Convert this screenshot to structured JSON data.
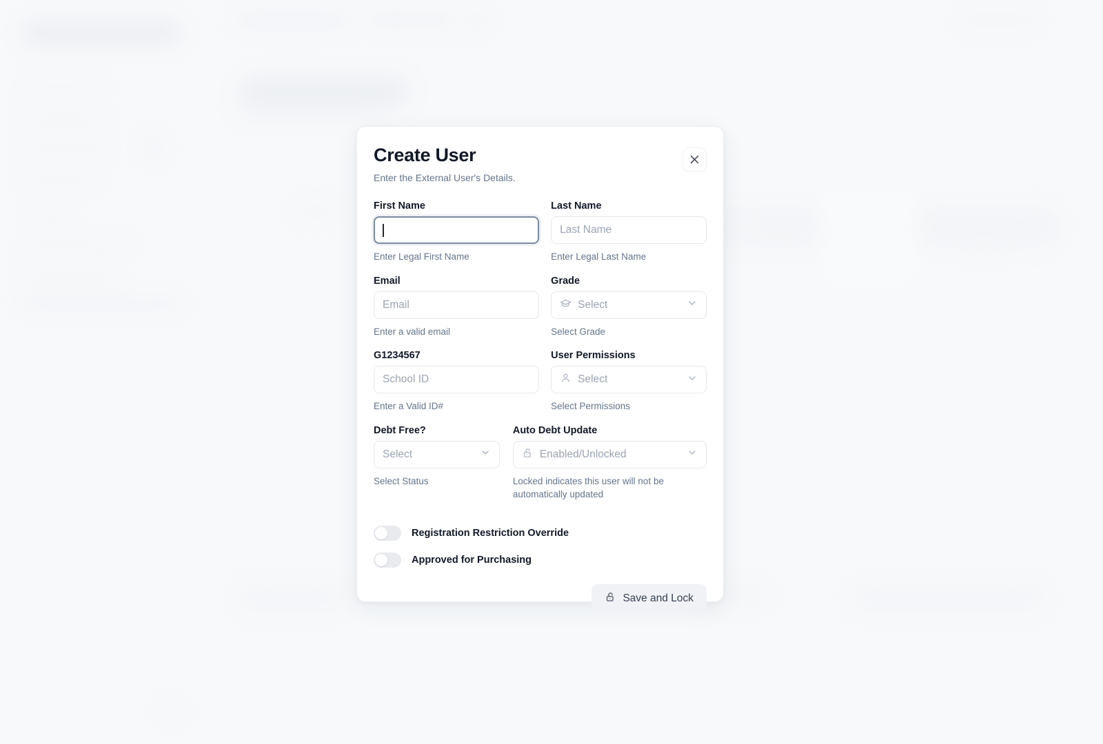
{
  "modal": {
    "title": "Create User",
    "subtitle": "Enter the External User's Details.",
    "close_icon": "close-icon",
    "fields": {
      "first_name": {
        "label": "First Name",
        "value": "",
        "placeholder": "",
        "help": "Enter Legal First Name",
        "focused": true
      },
      "last_name": {
        "label": "Last Name",
        "value": "",
        "placeholder": "Last Name",
        "help": "Enter Legal Last Name"
      },
      "email": {
        "label": "Email",
        "value": "",
        "placeholder": "Email",
        "help": "Enter a valid email"
      },
      "grade": {
        "label": "Grade",
        "value": "Select",
        "help": "Select Grade",
        "icon": "graduation-cap-icon",
        "chevron": "chevron-down-icon"
      },
      "school_id": {
        "label": "G1234567",
        "value": "",
        "placeholder": "School ID",
        "help": "Enter a Valid ID#"
      },
      "user_permissions": {
        "label": "User Permissions",
        "value": "Select",
        "help": "Select Permissions",
        "icon": "person-icon",
        "chevron": "chevron-down-icon"
      },
      "debt_free": {
        "label": "Debt Free?",
        "value": "Select",
        "help": "Select Status",
        "chevron": "chevron-down-icon"
      },
      "auto_debt_update": {
        "label": "Auto Debt Update",
        "value": "Enabled/Unlocked",
        "help": "Locked indicates this user will not be automatically updated",
        "icon": "unlock-icon",
        "chevron": "chevron-down-icon"
      }
    },
    "toggles": [
      {
        "label": "Registration Restriction Override",
        "checked": false
      },
      {
        "label": "Approved for Purchasing",
        "checked": false
      }
    ],
    "save_button": {
      "label": "Save and Lock",
      "icon": "unlock-icon"
    }
  },
  "colors": {
    "page_background": "#f7f8fa",
    "modal_background": "#ffffff",
    "title_text": "#111827",
    "muted_text": "#64748b",
    "placeholder_text": "#9aa3b2",
    "border": "#e3e7ed",
    "focus_border": "#7b899f",
    "toggle_track": "#e8eaee",
    "button_background": "#f1f2f5"
  }
}
